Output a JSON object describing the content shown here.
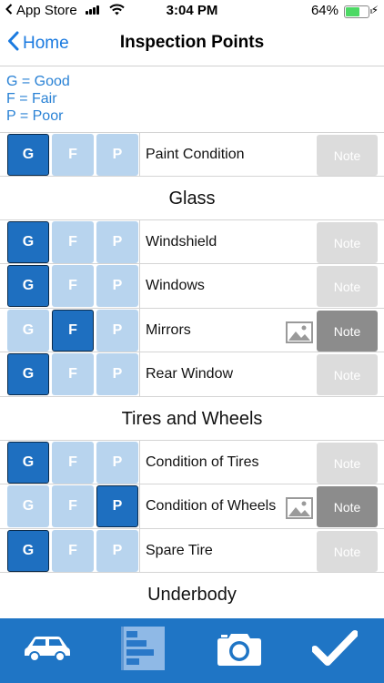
{
  "status_bar": {
    "back_app": "App Store",
    "time": "3:04 PM",
    "battery_percent": "64%",
    "battery_level": 0.64
  },
  "nav": {
    "back_label": "Home",
    "title": "Inspection Points"
  },
  "legend": {
    "good": "G = Good",
    "fair": "F = Fair",
    "poor": "P = Poor"
  },
  "rating_letters": {
    "g": "G",
    "f": "F",
    "p": "P"
  },
  "note_label": "Note",
  "sections": {
    "glass": "Glass",
    "tires": "Tires and Wheels",
    "underbody": "Underbody"
  },
  "items": {
    "paint": {
      "label": "Paint Condition",
      "rating": "G",
      "has_photo": false
    },
    "windshield": {
      "label": "Windshield",
      "rating": "G",
      "has_photo": false
    },
    "windows": {
      "label": "Windows",
      "rating": "G",
      "has_photo": false
    },
    "mirrors": {
      "label": "Mirrors",
      "rating": "F",
      "has_photo": true
    },
    "rear_window": {
      "label": "Rear Window",
      "rating": "G",
      "has_photo": false
    },
    "tire_condition": {
      "label": "Condition of Tires",
      "rating": "G",
      "has_photo": false
    },
    "wheel_condition": {
      "label": "Condition of Wheels",
      "rating": "P",
      "has_photo": true
    },
    "spare_tire": {
      "label": "Spare Tire",
      "rating": "G",
      "has_photo": false
    }
  },
  "tab_bar": {
    "tabs": [
      "car-icon",
      "list-icon",
      "camera-icon",
      "checkmark-icon"
    ],
    "active": "list-icon"
  },
  "colors": {
    "accent": "#1a7ae0",
    "selected": "#1e6fc0",
    "unselected": "#b8d4ee",
    "tab_bar": "#1f75c5"
  }
}
